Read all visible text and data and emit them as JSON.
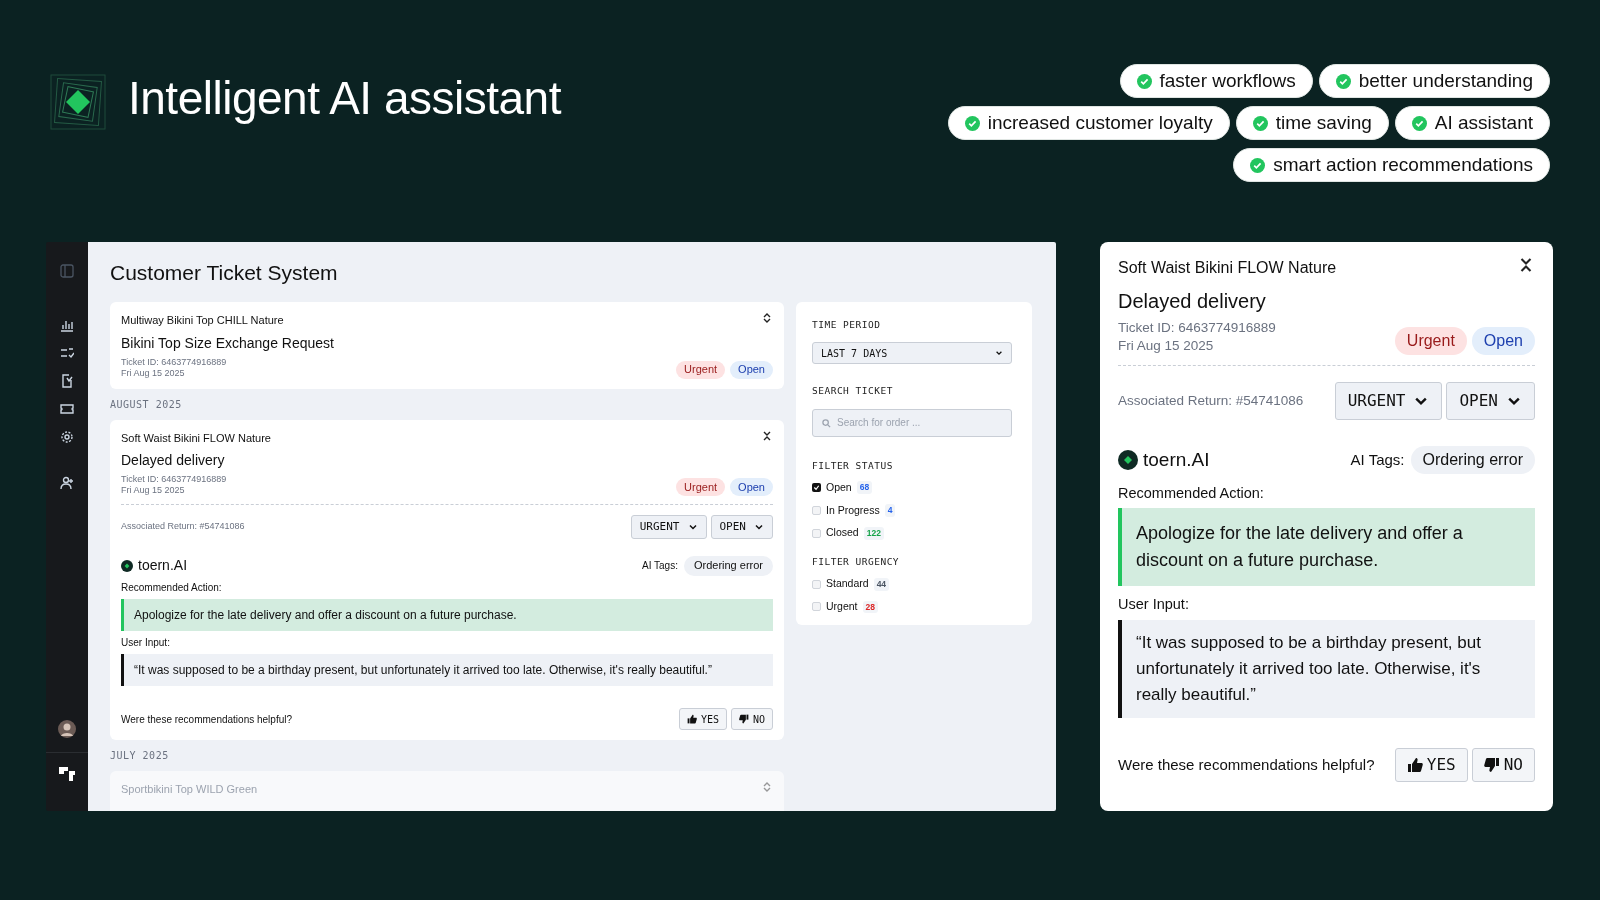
{
  "header": {
    "title": "Intelligent AI assistant"
  },
  "benefit_rows": [
    [
      "faster workflows",
      "better understanding"
    ],
    [
      "increased customer loyalty",
      "time saving",
      "AI assistant"
    ],
    [
      "smart action recommendations"
    ]
  ],
  "app": {
    "title": "Customer Ticket System",
    "feed": [
      {
        "kind": "ticket",
        "product": "Multiway Bikini Top CHILL Nature",
        "subject": "Bikini Top Size Exchange Request",
        "ticket_id": "Ticket ID: 6463774916889",
        "date": "Fri Aug 15 2025",
        "urgency": "Urgent",
        "status": "Open",
        "expanded": false,
        "faded": false
      },
      {
        "kind": "heading",
        "text": "AUGUST 2025"
      },
      {
        "kind": "ticket",
        "product": "Soft Waist Bikini FLOW Nature",
        "subject": "Delayed delivery",
        "ticket_id": "Ticket ID: 6463774916889",
        "date": "Fri Aug 15 2025",
        "urgency": "Urgent",
        "status": "Open",
        "expanded": true,
        "faded": false,
        "details": {
          "associated_return": "Associated Return: #54741086",
          "urgency_select": "URGENT",
          "status_select": "OPEN",
          "brand": "toern.AI",
          "tags_label": "AI Tags:",
          "tag": "Ordering error",
          "recommended_label": "Recommended Action:",
          "recommendation": "Apologize for the late delivery and offer a discount on a future purchase.",
          "input_label": "User Input:",
          "user_input": "“It was supposed to be a birthday present, but unfortunately it arrived too late. Otherwise, it's really beautiful.”",
          "feedback_question": "Were these recommendations helpful?",
          "yes": "YES",
          "no": "NO"
        }
      },
      {
        "kind": "heading",
        "text": "JULY 2025"
      },
      {
        "kind": "ticket",
        "product": "Sportbikini Top WILD Green",
        "expanded": false,
        "faded": true
      }
    ],
    "filters": {
      "time_label": "TIME PERIOD",
      "time_value": "LAST 7 DAYS",
      "search_label": "SEARCH TICKET",
      "search_placeholder": "Search for order ...",
      "groups": [
        {
          "label": "FILTER STATUS",
          "options": [
            {
              "label": "Open",
              "count": "68",
              "checked": true,
              "color": "#2563eb"
            },
            {
              "label": "In Progress",
              "count": "4",
              "checked": false,
              "color": "#2563eb"
            },
            {
              "label": "Closed",
              "count": "122",
              "checked": false,
              "color": "#16a34a"
            }
          ]
        },
        {
          "label": "FILTER URGENCY",
          "options": [
            {
              "label": "Standard",
              "count": "44",
              "checked": false,
              "color": "#4b5563"
            },
            {
              "label": "Urgent",
              "count": "28",
              "checked": false,
              "color": "#dc2626"
            }
          ]
        }
      ]
    }
  },
  "detail_card": {
    "product": "Soft Waist Bikini FLOW Nature",
    "subject": "Delayed delivery",
    "ticket_id": "Ticket ID: 6463774916889",
    "date": "Fri Aug 15 2025",
    "urgency": "Urgent",
    "status": "Open",
    "expanded": true,
    "details": {
      "associated_return": "Associated Return: #54741086",
      "urgency_select": "URGENT",
      "status_select": "OPEN",
      "brand": "toern.AI",
      "tags_label": "AI Tags:",
      "tag": "Ordering error",
      "recommended_label": "Recommended Action:",
      "recommendation": "Apologize for the late delivery and offer a discount on a future purchase.",
      "input_label": "User Input:",
      "user_input": "“It was supposed to be a birthday present, but unfortunately it arrived too late. Otherwise, it's really beautiful.”",
      "feedback_question": "Were these recommendations helpful?",
      "yes": "YES",
      "no": "NO"
    }
  }
}
